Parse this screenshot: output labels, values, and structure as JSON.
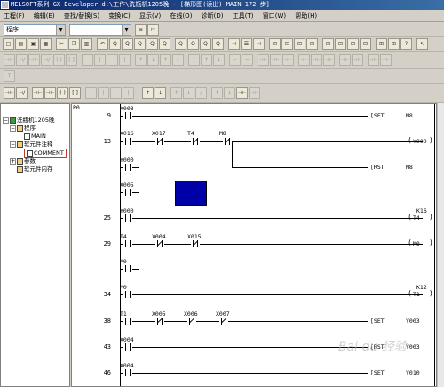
{
  "window": {
    "title": "MELSOFT系列 GX Developer d:\\工作\\洗瓶机1205晚 - [梯形图(读出)     MAIN    172 步]"
  },
  "menu": [
    "工程(F)",
    "编辑(E)",
    "查找/替换(S)",
    "变换(C)",
    "显示(V)",
    "在线(O)",
    "诊断(D)",
    "工具(T)",
    "窗口(W)",
    "帮助(H)"
  ],
  "toolbar": {
    "combo1_value": "程序",
    "combo2_value": ""
  },
  "tree": {
    "root": "洗瓶机1205晚",
    "program": "程序",
    "main": "MAIN",
    "comment_folder": "软元件注释",
    "comment": "COMMENT",
    "param": "参数",
    "memory": "软元件内存"
  },
  "ladder": {
    "p0": "P0",
    "rungs": [
      {
        "step": "9",
        "contacts": [
          "X003"
        ],
        "instr": "[SET",
        "target": "M8"
      },
      {
        "step": "13",
        "contacts": [
          "X016",
          "X017",
          "T4",
          "M8"
        ],
        "coil": "Y000",
        "branches": [
          "Y000",
          "X005"
        ],
        "instr2": "[RST",
        "target2": "M8"
      },
      {
        "step": "25",
        "contacts": [
          "Y000"
        ],
        "coil": "T4",
        "constant": "K16"
      },
      {
        "step": "29",
        "contacts": [
          "T4",
          "X004",
          "X015"
        ],
        "coil": "M0",
        "branches": [
          "M0"
        ]
      },
      {
        "step": "34",
        "contacts": [
          "M0"
        ],
        "coil": "T1",
        "constant": "K12"
      },
      {
        "step": "38",
        "contacts": [
          "T1",
          "X005",
          "X006",
          "X007"
        ],
        "instr": "[SET",
        "target": "Y003"
      },
      {
        "step": "43",
        "contacts": [
          "X004"
        ],
        "instr": "[RST",
        "target": "Y003"
      },
      {
        "step": "46",
        "contacts": [
          "X004"
        ],
        "instr": "[SET",
        "target": "Y010"
      }
    ]
  },
  "watermark": "Bai du 经验"
}
